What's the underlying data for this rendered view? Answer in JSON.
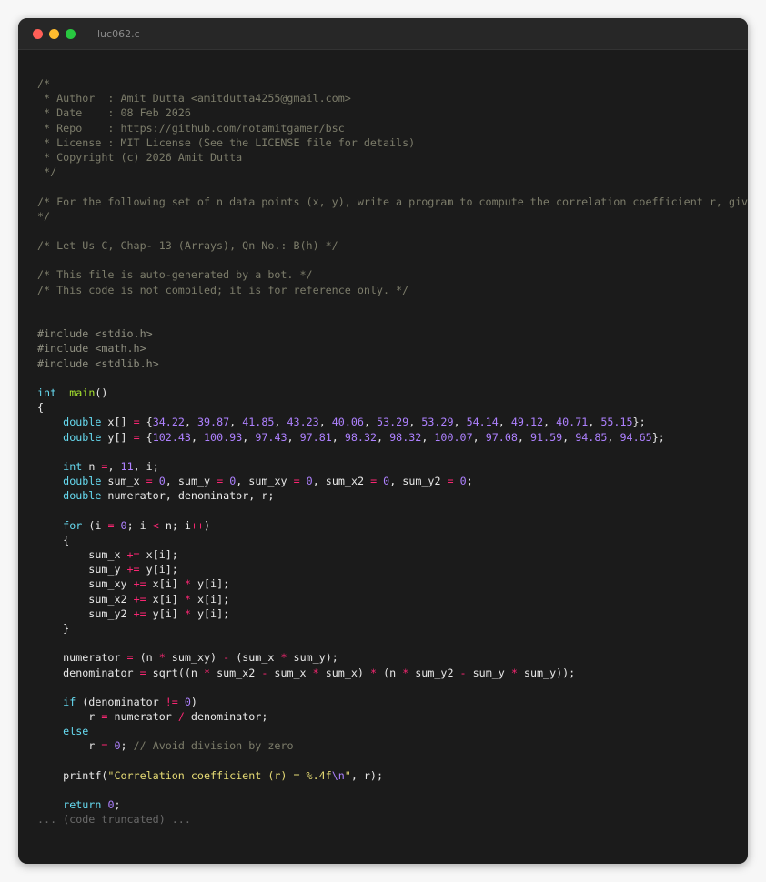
{
  "window": {
    "title": "luc062.c",
    "colors": {
      "background": "#1b1b1b",
      "titlebar": "#272727",
      "close": "#ff5f57",
      "minimize": "#febc2e",
      "maximize": "#28c840",
      "comment": "#7c7c6a",
      "keyword": "#66d9ef",
      "function": "#a6e22e",
      "number": "#ae81ff",
      "operator": "#f92672",
      "string": "#e6db74"
    }
  },
  "code": {
    "lines": [
      [
        [
          "cm",
          "/*"
        ]
      ],
      [
        [
          "cm",
          " * Author  : Amit Dutta <amitdutta4255@gmail.com>"
        ]
      ],
      [
        [
          "cm",
          " * Date    : 08 Feb 2026"
        ]
      ],
      [
        [
          "cm",
          " * Repo    : https://github.com/notamitgamer/bsc"
        ]
      ],
      [
        [
          "cm",
          " * License : MIT License (See the LICENSE file for details)"
        ]
      ],
      [
        [
          "cm",
          " * Copyright (c) 2026 Amit Dutta"
        ]
      ],
      [
        [
          "cm",
          " */"
        ]
      ],
      [],
      [
        [
          "cm",
          "/* For the following set of n data points (x, y), write a program to compute the correlation coefficient r, given by"
        ]
      ],
      [
        [
          "cm",
          "*/"
        ]
      ],
      [],
      [
        [
          "cm",
          "/* Let Us C, Chap- 13 (Arrays), Qn No.: B(h) */"
        ]
      ],
      [],
      [
        [
          "cm",
          "/* This file is auto-generated by a bot. */"
        ]
      ],
      [
        [
          "cm",
          "/* This code is not compiled; it is for reference only. */"
        ]
      ],
      [],
      [],
      [
        [
          "pp",
          "#include <stdio.h>"
        ]
      ],
      [
        [
          "pp",
          "#include <math.h>"
        ]
      ],
      [
        [
          "pp",
          "#include <stdlib.h>"
        ]
      ],
      [],
      [
        [
          "kw",
          "int"
        ],
        [
          "",
          "  "
        ],
        [
          "fn",
          "main"
        ],
        [
          "",
          "()"
        ]
      ],
      [
        [
          "",
          "{"
        ]
      ],
      [
        [
          "",
          "    "
        ],
        [
          "kw",
          "double"
        ],
        [
          "",
          " x[] "
        ],
        [
          "op",
          "="
        ],
        [
          "",
          " {"
        ],
        [
          "num",
          "34.22"
        ],
        [
          "",
          ", "
        ],
        [
          "num",
          "39.87"
        ],
        [
          "",
          ", "
        ],
        [
          "num",
          "41.85"
        ],
        [
          "",
          ", "
        ],
        [
          "num",
          "43.23"
        ],
        [
          "",
          ", "
        ],
        [
          "num",
          "40.06"
        ],
        [
          "",
          ", "
        ],
        [
          "num",
          "53.29"
        ],
        [
          "",
          ", "
        ],
        [
          "num",
          "53.29"
        ],
        [
          "",
          ", "
        ],
        [
          "num",
          "54.14"
        ],
        [
          "",
          ", "
        ],
        [
          "num",
          "49.12"
        ],
        [
          "",
          ", "
        ],
        [
          "num",
          "40.71"
        ],
        [
          "",
          ", "
        ],
        [
          "num",
          "55.15"
        ],
        [
          "",
          "};"
        ]
      ],
      [
        [
          "",
          "    "
        ],
        [
          "kw",
          "double"
        ],
        [
          "",
          " y[] "
        ],
        [
          "op",
          "="
        ],
        [
          "",
          " {"
        ],
        [
          "num",
          "102.43"
        ],
        [
          "",
          ", "
        ],
        [
          "num",
          "100.93"
        ],
        [
          "",
          ", "
        ],
        [
          "num",
          "97.43"
        ],
        [
          "",
          ", "
        ],
        [
          "num",
          "97.81"
        ],
        [
          "",
          ", "
        ],
        [
          "num",
          "98.32"
        ],
        [
          "",
          ", "
        ],
        [
          "num",
          "98.32"
        ],
        [
          "",
          ", "
        ],
        [
          "num",
          "100.07"
        ],
        [
          "",
          ", "
        ],
        [
          "num",
          "97.08"
        ],
        [
          "",
          ", "
        ],
        [
          "num",
          "91.59"
        ],
        [
          "",
          ", "
        ],
        [
          "num",
          "94.85"
        ],
        [
          "",
          ", "
        ],
        [
          "num",
          "94.65"
        ],
        [
          "",
          "};"
        ]
      ],
      [],
      [
        [
          "",
          "    "
        ],
        [
          "kw",
          "int"
        ],
        [
          "",
          " n "
        ],
        [
          "op",
          "="
        ],
        [
          "",
          ", "
        ],
        [
          "num",
          "11"
        ],
        [
          "",
          ", i;"
        ]
      ],
      [
        [
          "",
          "    "
        ],
        [
          "kw",
          "double"
        ],
        [
          "",
          " sum_x "
        ],
        [
          "op",
          "="
        ],
        [
          "",
          " "
        ],
        [
          "num",
          "0"
        ],
        [
          "",
          ", sum_y "
        ],
        [
          "op",
          "="
        ],
        [
          "",
          " "
        ],
        [
          "num",
          "0"
        ],
        [
          "",
          ", sum_xy "
        ],
        [
          "op",
          "="
        ],
        [
          "",
          " "
        ],
        [
          "num",
          "0"
        ],
        [
          "",
          ", sum_x2 "
        ],
        [
          "op",
          "="
        ],
        [
          "",
          " "
        ],
        [
          "num",
          "0"
        ],
        [
          "",
          ", sum_y2 "
        ],
        [
          "op",
          "="
        ],
        [
          "",
          " "
        ],
        [
          "num",
          "0"
        ],
        [
          "",
          ";"
        ]
      ],
      [
        [
          "",
          "    "
        ],
        [
          "kw",
          "double"
        ],
        [
          "",
          " numerator, denominator, r;"
        ]
      ],
      [],
      [
        [
          "",
          "    "
        ],
        [
          "kw",
          "for"
        ],
        [
          "",
          " (i "
        ],
        [
          "op",
          "="
        ],
        [
          "",
          " "
        ],
        [
          "num",
          "0"
        ],
        [
          "",
          "; i "
        ],
        [
          "op",
          "<"
        ],
        [
          "",
          " n; i"
        ],
        [
          "op",
          "++"
        ],
        [
          "",
          ")"
        ]
      ],
      [
        [
          "",
          "    {"
        ]
      ],
      [
        [
          "",
          "        sum_x "
        ],
        [
          "op",
          "+="
        ],
        [
          "",
          " x[i];"
        ]
      ],
      [
        [
          "",
          "        sum_y "
        ],
        [
          "op",
          "+="
        ],
        [
          "",
          " y[i];"
        ]
      ],
      [
        [
          "",
          "        sum_xy "
        ],
        [
          "op",
          "+="
        ],
        [
          "",
          " x[i] "
        ],
        [
          "op",
          "*"
        ],
        [
          "",
          " y[i];"
        ]
      ],
      [
        [
          "",
          "        sum_x2 "
        ],
        [
          "op",
          "+="
        ],
        [
          "",
          " x[i] "
        ],
        [
          "op",
          "*"
        ],
        [
          "",
          " x[i];"
        ]
      ],
      [
        [
          "",
          "        sum_y2 "
        ],
        [
          "op",
          "+="
        ],
        [
          "",
          " y[i] "
        ],
        [
          "op",
          "*"
        ],
        [
          "",
          " y[i];"
        ]
      ],
      [
        [
          "",
          "    }"
        ]
      ],
      [],
      [
        [
          "",
          "    numerator "
        ],
        [
          "op",
          "="
        ],
        [
          "",
          " (n "
        ],
        [
          "op",
          "*"
        ],
        [
          "",
          " sum_xy) "
        ],
        [
          "op",
          "-"
        ],
        [
          "",
          " (sum_x "
        ],
        [
          "op",
          "*"
        ],
        [
          "",
          " sum_y);"
        ]
      ],
      [
        [
          "",
          "    denominator "
        ],
        [
          "op",
          "="
        ],
        [
          "",
          " sqrt((n "
        ],
        [
          "op",
          "*"
        ],
        [
          "",
          " sum_x2 "
        ],
        [
          "op",
          "-"
        ],
        [
          "",
          " sum_x "
        ],
        [
          "op",
          "*"
        ],
        [
          "",
          " sum_x) "
        ],
        [
          "op",
          "*"
        ],
        [
          "",
          " (n "
        ],
        [
          "op",
          "*"
        ],
        [
          "",
          " sum_y2 "
        ],
        [
          "op",
          "-"
        ],
        [
          "",
          " sum_y "
        ],
        [
          "op",
          "*"
        ],
        [
          "",
          " sum_y));"
        ]
      ],
      [],
      [
        [
          "",
          "    "
        ],
        [
          "kw",
          "if"
        ],
        [
          "",
          " (denominator "
        ],
        [
          "op",
          "!="
        ],
        [
          "",
          " "
        ],
        [
          "num",
          "0"
        ],
        [
          "",
          ")"
        ]
      ],
      [
        [
          "",
          "        r "
        ],
        [
          "op",
          "="
        ],
        [
          "",
          " numerator "
        ],
        [
          "op",
          "/"
        ],
        [
          "",
          " denominator;"
        ]
      ],
      [
        [
          "",
          "    "
        ],
        [
          "kw",
          "else"
        ]
      ],
      [
        [
          "",
          "        r "
        ],
        [
          "op",
          "="
        ],
        [
          "",
          " "
        ],
        [
          "num",
          "0"
        ],
        [
          "",
          "; "
        ],
        [
          "cm",
          "// Avoid division by zero"
        ]
      ],
      [],
      [
        [
          "",
          "    printf("
        ],
        [
          "str",
          "\"Correlation coefficient (r) = %.4f"
        ],
        [
          "esc",
          "\\n"
        ],
        [
          "str",
          "\""
        ],
        [
          "",
          ", r);"
        ]
      ],
      [],
      [
        [
          "",
          "    "
        ],
        [
          "kw",
          "return"
        ],
        [
          "",
          " "
        ],
        [
          "num",
          "0"
        ],
        [
          "",
          ";"
        ]
      ],
      [
        [
          "trunc",
          "... (code truncated) ..."
        ]
      ]
    ]
  }
}
